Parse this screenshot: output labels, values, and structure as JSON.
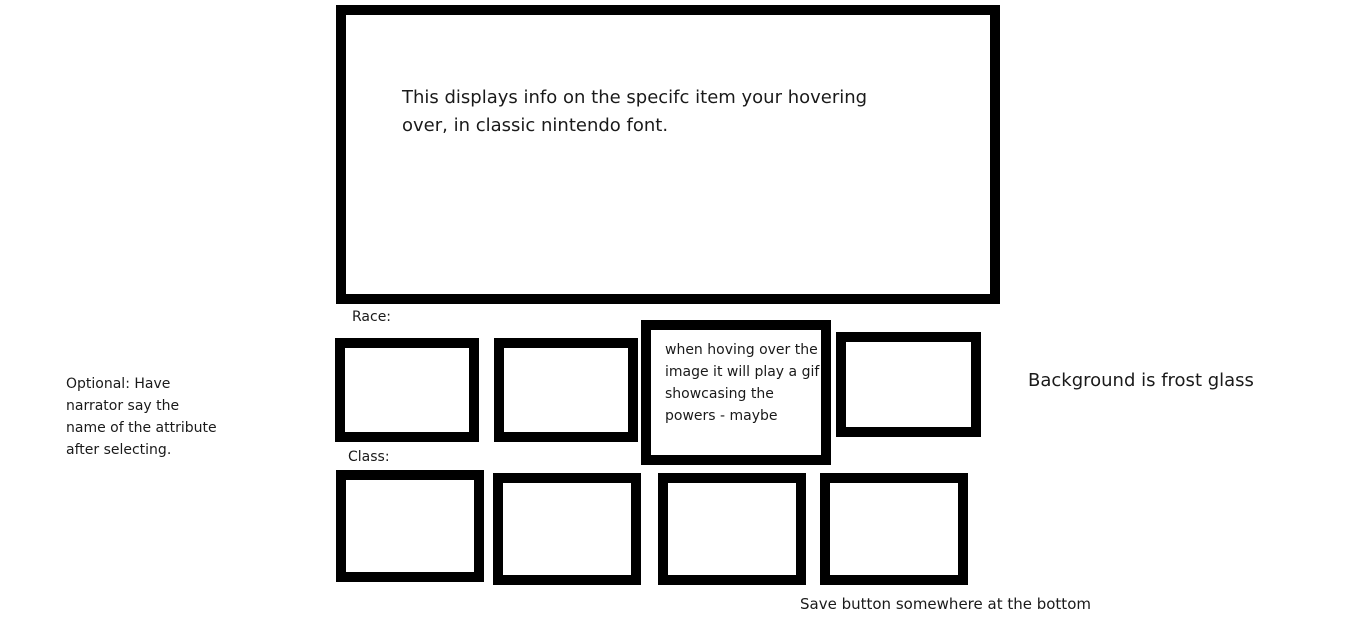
{
  "info_panel": {
    "text": "This displays info on the specifc item your hovering\nover, in classic nintendo font."
  },
  "race": {
    "label": "Race:",
    "tile_note": "when hoving over\nthe image it will\nplay a gif\nshowcasing the\npowers - maybe"
  },
  "class": {
    "label": "Class:"
  },
  "notes": {
    "narrator": "Optional: Have\nnarrator say the\nname of the attribute\nafter selecting.",
    "background": "Background is frost glass",
    "save": "Save button somewhere at the bottom"
  }
}
